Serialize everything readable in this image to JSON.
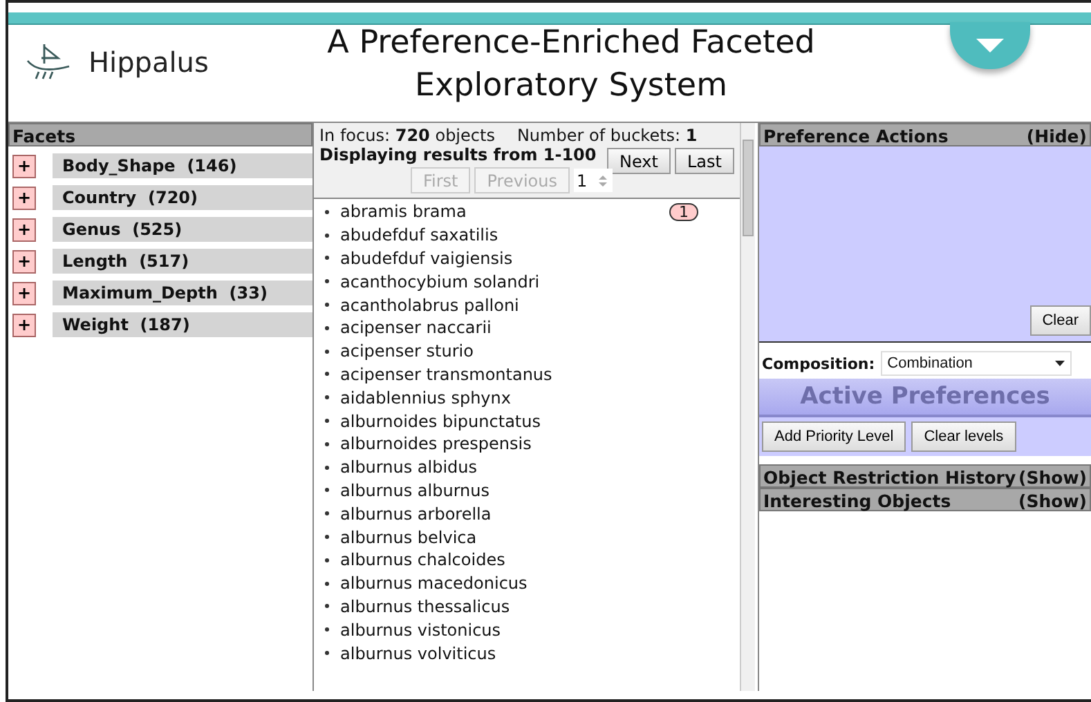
{
  "header": {
    "logo_text": "Hippalus",
    "title": "A Preference-Enriched Faceted Exploratory System"
  },
  "facets": {
    "heading": "Facets",
    "items": [
      {
        "expand": "+",
        "name": "Body_Shape",
        "count": "(146)"
      },
      {
        "expand": "+",
        "name": "Country",
        "count": "(720)"
      },
      {
        "expand": "+",
        "name": "Genus",
        "count": "(525)"
      },
      {
        "expand": "+",
        "name": "Length",
        "count": "(517)"
      },
      {
        "expand": "+",
        "name": "Maximum_Depth",
        "count": "(33)"
      },
      {
        "expand": "+",
        "name": "Weight",
        "count": "(187)"
      }
    ]
  },
  "results": {
    "focus_label": "In focus:",
    "focus_value": "720 objects",
    "buckets_label": "Number of buckets:",
    "buckets_value": "1",
    "range": "Displaying results from 1-100",
    "buttons": [
      {
        "label": "Next",
        "disabled": false
      },
      {
        "label": "Last",
        "disabled": false
      }
    ],
    "nav_buttons": [
      {
        "label": "First",
        "disabled": true
      },
      {
        "label": "Previous",
        "disabled": true
      }
    ],
    "page": "1",
    "items": [
      {
        "name": "abramis brama",
        "badge": "1"
      },
      {
        "name": "abudefduf saxatilis"
      },
      {
        "name": "abudefduf vaigiensis"
      },
      {
        "name": "acanthocybium solandri"
      },
      {
        "name": "acantholabrus palloni"
      },
      {
        "name": "acipenser naccarii"
      },
      {
        "name": "acipenser sturio"
      },
      {
        "name": "acipenser transmontanus"
      },
      {
        "name": "aidablennius sphynx"
      },
      {
        "name": "alburnoides bipunctatus"
      },
      {
        "name": "alburnoides prespensis"
      },
      {
        "name": "alburnus albidus"
      },
      {
        "name": "alburnus alburnus"
      },
      {
        "name": "alburnus arborella"
      },
      {
        "name": "alburnus belvica"
      },
      {
        "name": "alburnus chalcoides"
      },
      {
        "name": "alburnus macedonicus"
      },
      {
        "name": "alburnus thessalicus"
      },
      {
        "name": "alburnus vistonicus"
      },
      {
        "name": "alburnus volviticus"
      }
    ]
  },
  "preferences": {
    "heading": "Preference Actions",
    "toggle": "(Hide)",
    "clear": "Clear",
    "composition_label": "Composition:",
    "composition_value": "Combination",
    "active_heading": "Active Preferences",
    "buttons": [
      "Add Priority Level",
      "Clear levels"
    ]
  },
  "sections": [
    {
      "title": "Object Restriction History",
      "toggle": "(Show)"
    },
    {
      "title": "Interesting Objects",
      "toggle": "(Show)"
    }
  ]
}
